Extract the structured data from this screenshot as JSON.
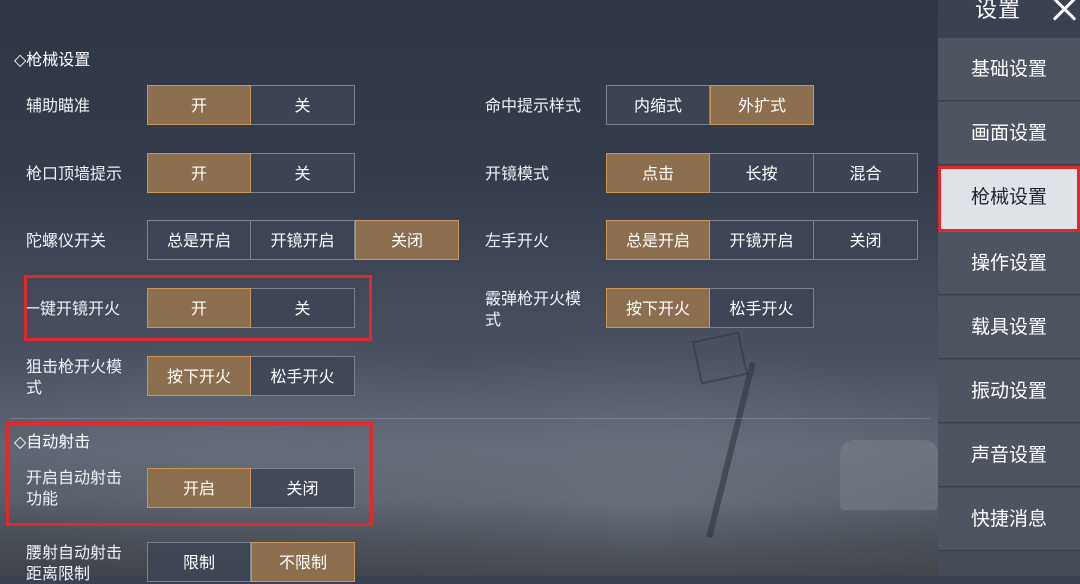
{
  "header": {
    "title": "设置"
  },
  "sidebar": {
    "items": [
      {
        "label": "基础设置"
      },
      {
        "label": "画面设置"
      },
      {
        "label": "枪械设置"
      },
      {
        "label": "操作设置"
      },
      {
        "label": "载具设置"
      },
      {
        "label": "振动设置"
      },
      {
        "label": "声音设置"
      },
      {
        "label": "快捷消息"
      }
    ]
  },
  "sections": {
    "firearms": "◇枪械设置",
    "auto_fire": "◇自动射击"
  },
  "settings": {
    "aim_assist": {
      "label": "辅助瞄准",
      "options": [
        "开",
        "关"
      ],
      "selected": "开"
    },
    "muzzle_wall": {
      "label": "枪口顶墙提示",
      "options": [
        "开",
        "关"
      ],
      "selected": "开"
    },
    "gyroscope": {
      "label": "陀螺仪开关",
      "options": [
        "总是开启",
        "开镜开启",
        "关闭"
      ],
      "selected": "关闭"
    },
    "one_key_scope_fire": {
      "label": "一键开镜开火",
      "options": [
        "开",
        "关"
      ],
      "selected": "开"
    },
    "sniper_fire_mode": {
      "label_line1": "狙击枪开火模",
      "label_line2": "式",
      "options": [
        "按下开火",
        "松手开火"
      ],
      "selected": "按下开火"
    },
    "hit_indicator": {
      "label": "命中提示样式",
      "options": [
        "内缩式",
        "外扩式"
      ],
      "selected": "外扩式"
    },
    "scope_mode": {
      "label": "开镜模式",
      "options": [
        "点击",
        "长按",
        "混合"
      ],
      "selected": "点击"
    },
    "left_hand_fire": {
      "label": "左手开火",
      "options": [
        "总是开启",
        "开镜开启",
        "关闭"
      ],
      "selected": "总是开启"
    },
    "shotgun_fire_mode": {
      "label_line1": "霰弹枪开火模",
      "label_line2": "式",
      "options": [
        "按下开火",
        "松手开火"
      ],
      "selected": "按下开火"
    },
    "auto_fire_enable": {
      "label_line1": "开启自动射击",
      "label_line2": "功能",
      "options": [
        "开启",
        "关闭"
      ],
      "selected": "开启"
    },
    "hip_auto_fire": {
      "label_line1": "腰射自动射击",
      "label_line2": "距离限制",
      "options": [
        "限制",
        "不限制"
      ],
      "selected": "不限制"
    }
  },
  "colors": {
    "selected": "#8c6f4e",
    "selected_border": "#c99558",
    "highlight": "#e0282e"
  }
}
